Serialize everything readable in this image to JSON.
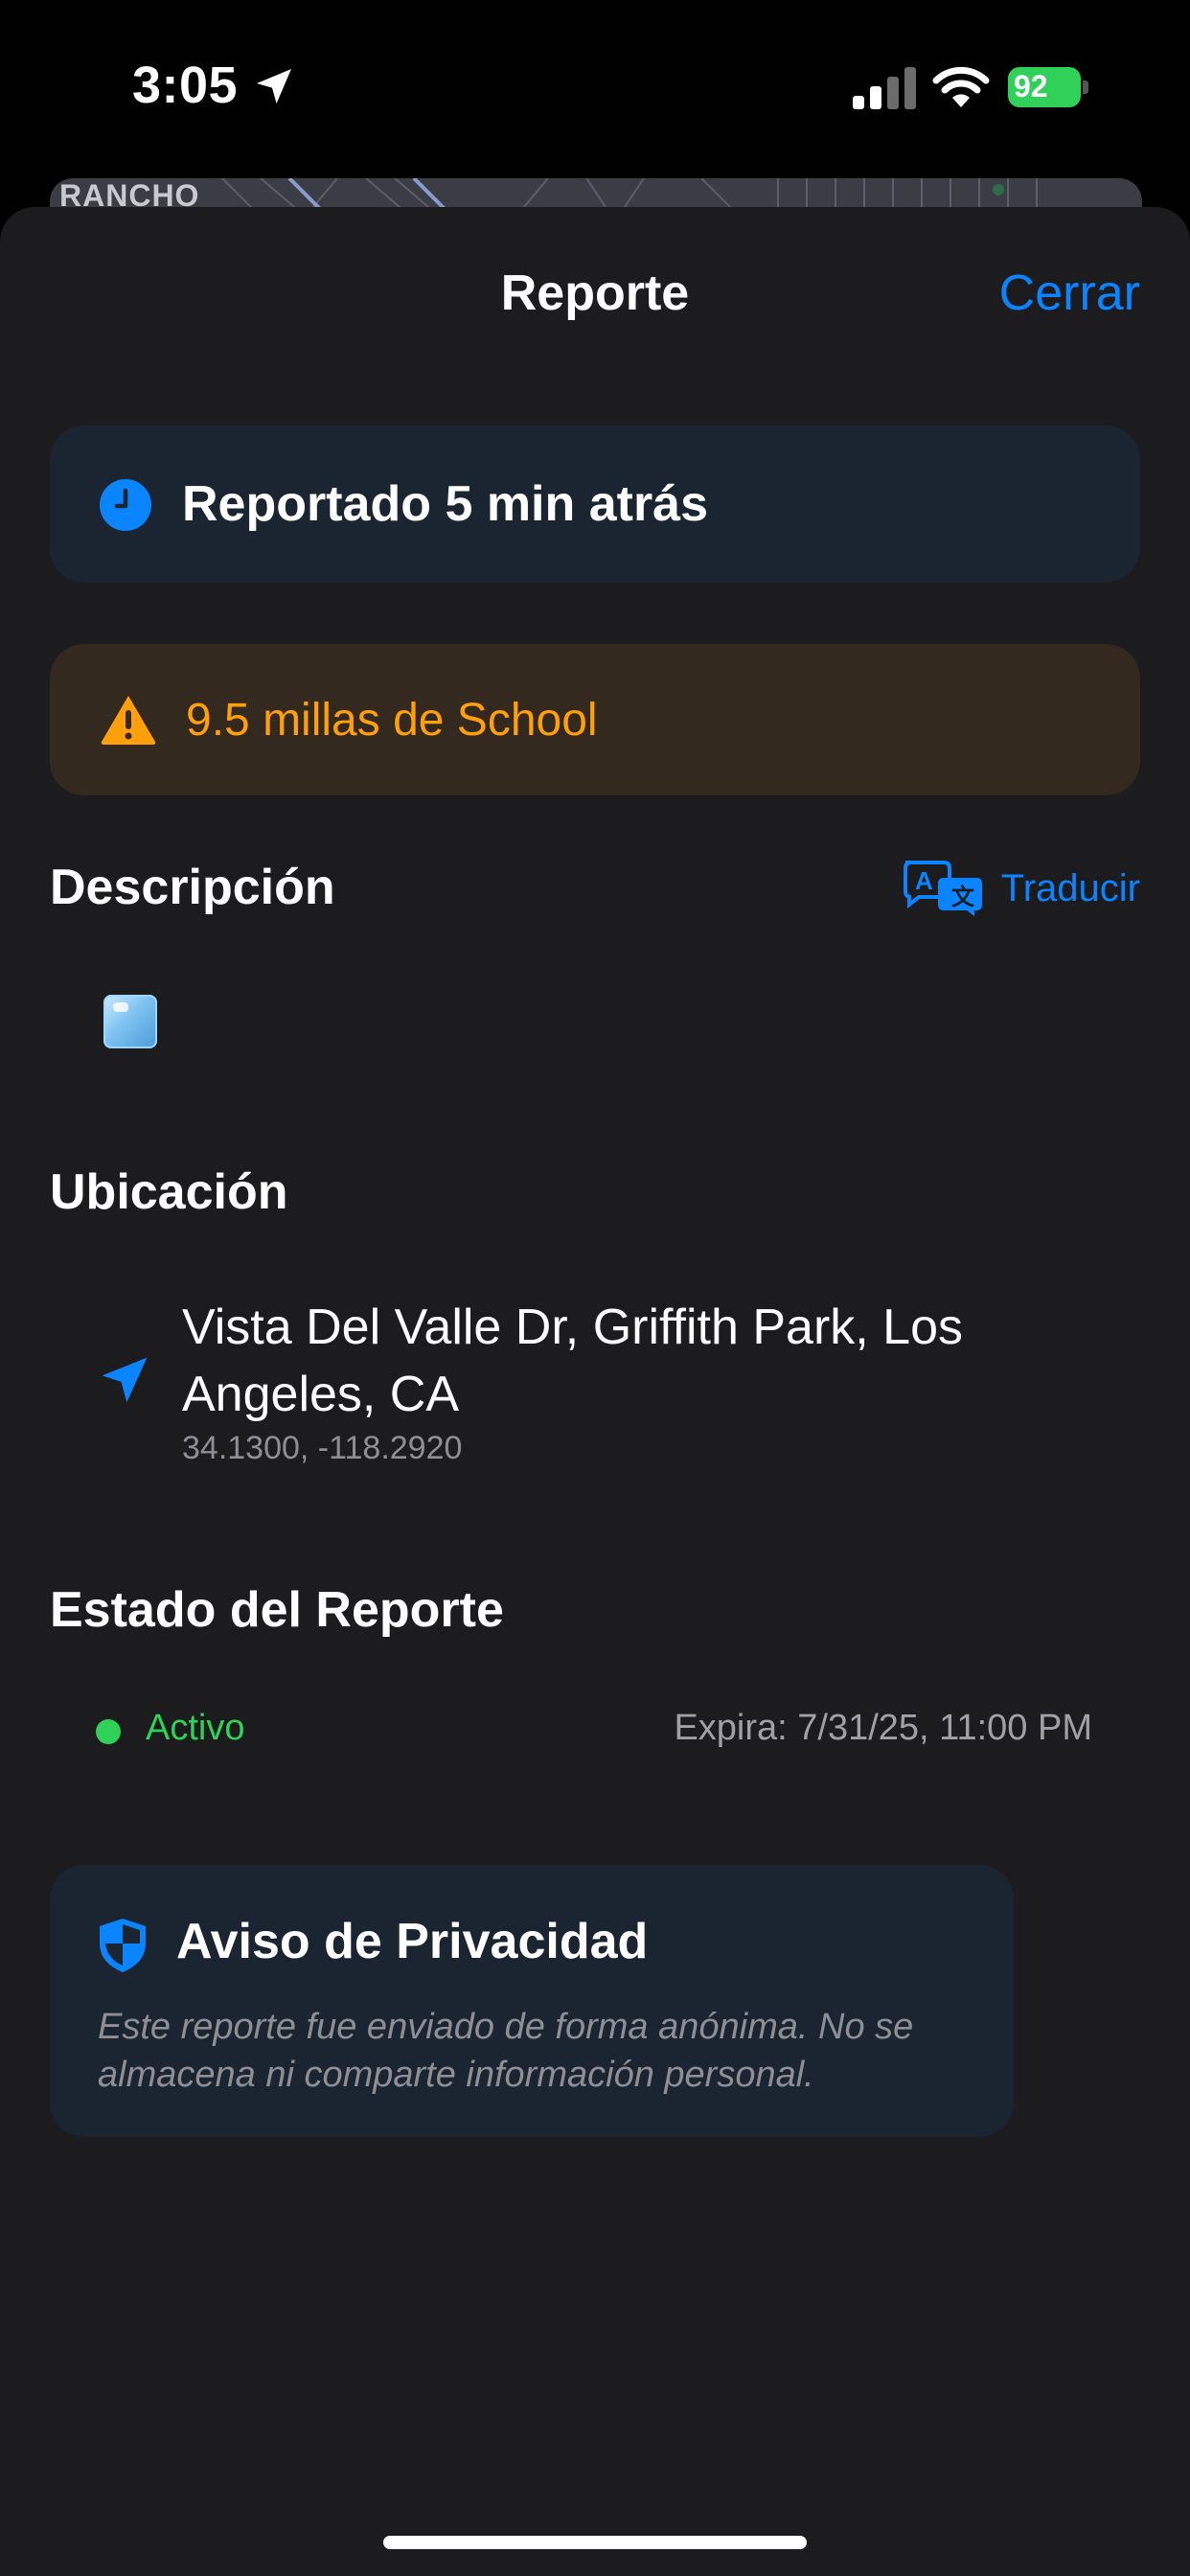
{
  "status_bar": {
    "time": "3:05",
    "battery": "92"
  },
  "map": {
    "label": "RANCHO"
  },
  "header": {
    "title": "Reporte",
    "close_label": "Cerrar"
  },
  "report_time": {
    "text": "Reportado 5 min atrás"
  },
  "distance_warning": {
    "text": "9.5 millas de School"
  },
  "description": {
    "title": "Descripción",
    "translate_label": "Traducir",
    "content_icon": "ice-cube-icon"
  },
  "location": {
    "title": "Ubicación",
    "address": "Vista Del Valle Dr, Griffith Park, Los Angeles, CA",
    "coordinates": "34.1300, -118.2920"
  },
  "report_status": {
    "title": "Estado del Reporte",
    "status": "Activo",
    "expiry": "Expira: 7/31/25, 11:00 PM"
  },
  "privacy": {
    "title": "Aviso de Privacidad",
    "body": "Este reporte fue enviado de forma anónima. No se almacena ni comparte información personal."
  },
  "colors": {
    "accent": "#0a84ff",
    "warning": "#ff9f0a",
    "active": "#30d158",
    "sheet_bg": "#1c1c1e"
  }
}
